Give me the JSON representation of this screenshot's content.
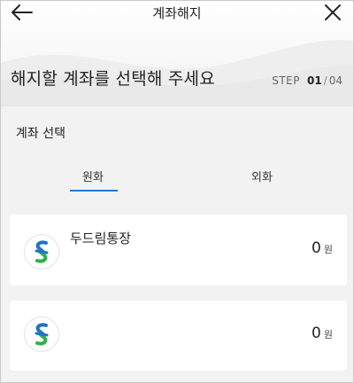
{
  "header": {
    "title": "계좌해지",
    "heading": "해지할 계좌를 선택해 주세요",
    "step_label": "STEP",
    "step_current": "01",
    "step_separator": "/",
    "step_total": "04"
  },
  "section": {
    "title": "계좌 선택"
  },
  "tabs": [
    {
      "label": "원화",
      "active": true
    },
    {
      "label": "외화",
      "active": false
    }
  ],
  "accounts": [
    {
      "name": "두드림통장",
      "amount": "0",
      "unit": "원"
    },
    {
      "name": "",
      "amount": "0",
      "unit": "원"
    }
  ],
  "colors": {
    "accent": "#1f7bd1",
    "logo_blue": "#1e73c9",
    "logo_green": "#2bb24c"
  },
  "icons": [
    "arrow-left-icon",
    "close-icon",
    "bank-logo-icon"
  ]
}
